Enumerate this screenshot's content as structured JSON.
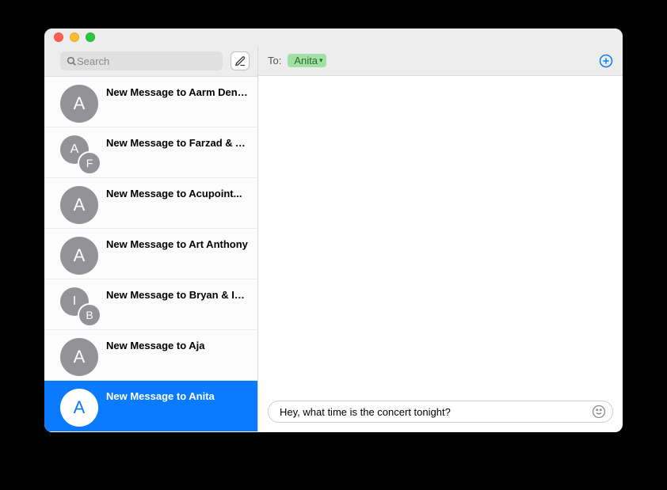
{
  "search": {
    "placeholder": "Search",
    "value": ""
  },
  "to": {
    "label": "To:",
    "recipient": "Anita"
  },
  "compose_input": {
    "value": "Hey, what time is the concert tonight?"
  },
  "conversations": [
    {
      "title": "New Message to Aarm Dental",
      "avatars": [
        "A"
      ],
      "selected": false
    },
    {
      "title": "New Message to Farzad & A...",
      "avatars": [
        "A",
        "F"
      ],
      "selected": false
    },
    {
      "title": "New Message to Acupoint...",
      "avatars": [
        "A"
      ],
      "selected": false
    },
    {
      "title": "New Message to Art Anthony",
      "avatars": [
        "A"
      ],
      "selected": false
    },
    {
      "title": "New Message to Bryan & Im...",
      "avatars": [
        "I",
        "B"
      ],
      "selected": false
    },
    {
      "title": "New Message to Aja",
      "avatars": [
        "A"
      ],
      "selected": false
    },
    {
      "title": "New Message to Anita",
      "avatars": [
        "A"
      ],
      "selected": true
    }
  ]
}
